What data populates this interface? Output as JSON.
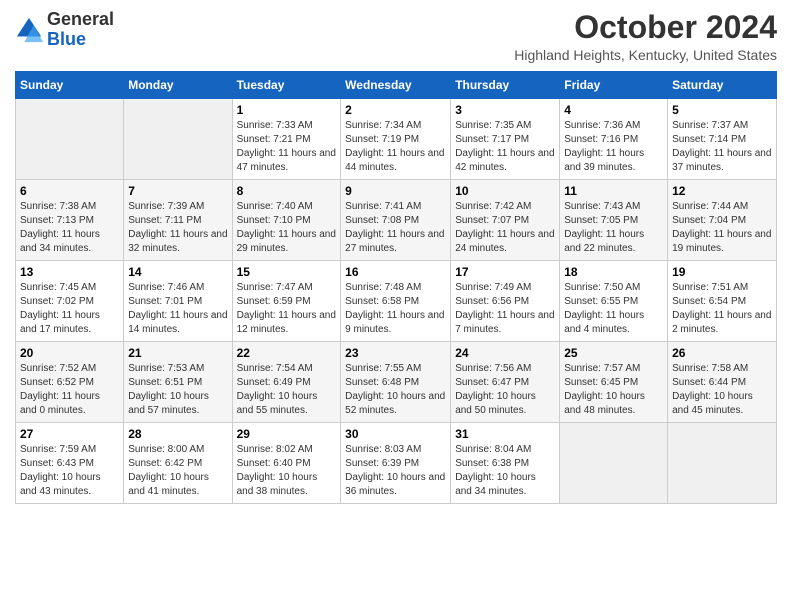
{
  "app": {
    "name": "GeneralBlue",
    "logo_shape": "triangle"
  },
  "header": {
    "month": "October 2024",
    "location": "Highland Heights, Kentucky, United States"
  },
  "weekdays": [
    "Sunday",
    "Monday",
    "Tuesday",
    "Wednesday",
    "Thursday",
    "Friday",
    "Saturday"
  ],
  "weeks": [
    [
      {
        "day": "",
        "sunrise": "",
        "sunset": "",
        "daylight": ""
      },
      {
        "day": "",
        "sunrise": "",
        "sunset": "",
        "daylight": ""
      },
      {
        "day": "1",
        "sunrise": "Sunrise: 7:33 AM",
        "sunset": "Sunset: 7:21 PM",
        "daylight": "Daylight: 11 hours and 47 minutes."
      },
      {
        "day": "2",
        "sunrise": "Sunrise: 7:34 AM",
        "sunset": "Sunset: 7:19 PM",
        "daylight": "Daylight: 11 hours and 44 minutes."
      },
      {
        "day": "3",
        "sunrise": "Sunrise: 7:35 AM",
        "sunset": "Sunset: 7:17 PM",
        "daylight": "Daylight: 11 hours and 42 minutes."
      },
      {
        "day": "4",
        "sunrise": "Sunrise: 7:36 AM",
        "sunset": "Sunset: 7:16 PM",
        "daylight": "Daylight: 11 hours and 39 minutes."
      },
      {
        "day": "5",
        "sunrise": "Sunrise: 7:37 AM",
        "sunset": "Sunset: 7:14 PM",
        "daylight": "Daylight: 11 hours and 37 minutes."
      }
    ],
    [
      {
        "day": "6",
        "sunrise": "Sunrise: 7:38 AM",
        "sunset": "Sunset: 7:13 PM",
        "daylight": "Daylight: 11 hours and 34 minutes."
      },
      {
        "day": "7",
        "sunrise": "Sunrise: 7:39 AM",
        "sunset": "Sunset: 7:11 PM",
        "daylight": "Daylight: 11 hours and 32 minutes."
      },
      {
        "day": "8",
        "sunrise": "Sunrise: 7:40 AM",
        "sunset": "Sunset: 7:10 PM",
        "daylight": "Daylight: 11 hours and 29 minutes."
      },
      {
        "day": "9",
        "sunrise": "Sunrise: 7:41 AM",
        "sunset": "Sunset: 7:08 PM",
        "daylight": "Daylight: 11 hours and 27 minutes."
      },
      {
        "day": "10",
        "sunrise": "Sunrise: 7:42 AM",
        "sunset": "Sunset: 7:07 PM",
        "daylight": "Daylight: 11 hours and 24 minutes."
      },
      {
        "day": "11",
        "sunrise": "Sunrise: 7:43 AM",
        "sunset": "Sunset: 7:05 PM",
        "daylight": "Daylight: 11 hours and 22 minutes."
      },
      {
        "day": "12",
        "sunrise": "Sunrise: 7:44 AM",
        "sunset": "Sunset: 7:04 PM",
        "daylight": "Daylight: 11 hours and 19 minutes."
      }
    ],
    [
      {
        "day": "13",
        "sunrise": "Sunrise: 7:45 AM",
        "sunset": "Sunset: 7:02 PM",
        "daylight": "Daylight: 11 hours and 17 minutes."
      },
      {
        "day": "14",
        "sunrise": "Sunrise: 7:46 AM",
        "sunset": "Sunset: 7:01 PM",
        "daylight": "Daylight: 11 hours and 14 minutes."
      },
      {
        "day": "15",
        "sunrise": "Sunrise: 7:47 AM",
        "sunset": "Sunset: 6:59 PM",
        "daylight": "Daylight: 11 hours and 12 minutes."
      },
      {
        "day": "16",
        "sunrise": "Sunrise: 7:48 AM",
        "sunset": "Sunset: 6:58 PM",
        "daylight": "Daylight: 11 hours and 9 minutes."
      },
      {
        "day": "17",
        "sunrise": "Sunrise: 7:49 AM",
        "sunset": "Sunset: 6:56 PM",
        "daylight": "Daylight: 11 hours and 7 minutes."
      },
      {
        "day": "18",
        "sunrise": "Sunrise: 7:50 AM",
        "sunset": "Sunset: 6:55 PM",
        "daylight": "Daylight: 11 hours and 4 minutes."
      },
      {
        "day": "19",
        "sunrise": "Sunrise: 7:51 AM",
        "sunset": "Sunset: 6:54 PM",
        "daylight": "Daylight: 11 hours and 2 minutes."
      }
    ],
    [
      {
        "day": "20",
        "sunrise": "Sunrise: 7:52 AM",
        "sunset": "Sunset: 6:52 PM",
        "daylight": "Daylight: 11 hours and 0 minutes."
      },
      {
        "day": "21",
        "sunrise": "Sunrise: 7:53 AM",
        "sunset": "Sunset: 6:51 PM",
        "daylight": "Daylight: 10 hours and 57 minutes."
      },
      {
        "day": "22",
        "sunrise": "Sunrise: 7:54 AM",
        "sunset": "Sunset: 6:49 PM",
        "daylight": "Daylight: 10 hours and 55 minutes."
      },
      {
        "day": "23",
        "sunrise": "Sunrise: 7:55 AM",
        "sunset": "Sunset: 6:48 PM",
        "daylight": "Daylight: 10 hours and 52 minutes."
      },
      {
        "day": "24",
        "sunrise": "Sunrise: 7:56 AM",
        "sunset": "Sunset: 6:47 PM",
        "daylight": "Daylight: 10 hours and 50 minutes."
      },
      {
        "day": "25",
        "sunrise": "Sunrise: 7:57 AM",
        "sunset": "Sunset: 6:45 PM",
        "daylight": "Daylight: 10 hours and 48 minutes."
      },
      {
        "day": "26",
        "sunrise": "Sunrise: 7:58 AM",
        "sunset": "Sunset: 6:44 PM",
        "daylight": "Daylight: 10 hours and 45 minutes."
      }
    ],
    [
      {
        "day": "27",
        "sunrise": "Sunrise: 7:59 AM",
        "sunset": "Sunset: 6:43 PM",
        "daylight": "Daylight: 10 hours and 43 minutes."
      },
      {
        "day": "28",
        "sunrise": "Sunrise: 8:00 AM",
        "sunset": "Sunset: 6:42 PM",
        "daylight": "Daylight: 10 hours and 41 minutes."
      },
      {
        "day": "29",
        "sunrise": "Sunrise: 8:02 AM",
        "sunset": "Sunset: 6:40 PM",
        "daylight": "Daylight: 10 hours and 38 minutes."
      },
      {
        "day": "30",
        "sunrise": "Sunrise: 8:03 AM",
        "sunset": "Sunset: 6:39 PM",
        "daylight": "Daylight: 10 hours and 36 minutes."
      },
      {
        "day": "31",
        "sunrise": "Sunrise: 8:04 AM",
        "sunset": "Sunset: 6:38 PM",
        "daylight": "Daylight: 10 hours and 34 minutes."
      },
      {
        "day": "",
        "sunrise": "",
        "sunset": "",
        "daylight": ""
      },
      {
        "day": "",
        "sunrise": "",
        "sunset": "",
        "daylight": ""
      }
    ]
  ]
}
